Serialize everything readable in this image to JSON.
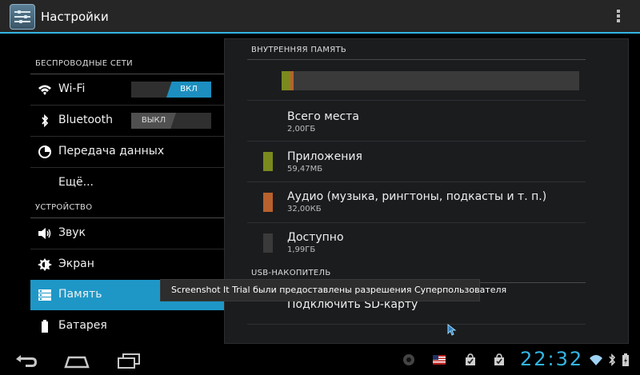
{
  "header": {
    "title": "Настройки",
    "app_icon": "settings-sliders-icon",
    "menu_icon": "overflow-menu-icon"
  },
  "sidebar": {
    "sections": [
      {
        "title": "БЕСПРОВОДНЫЕ СЕТИ",
        "items": [
          {
            "label": "Wi-Fi",
            "icon": "wifi-icon",
            "toggle": "ВКЛ",
            "toggle_state": "on"
          },
          {
            "label": "Bluetooth",
            "icon": "bluetooth-icon",
            "toggle": "ВЫКЛ",
            "toggle_state": "off"
          },
          {
            "label": "Передача данных",
            "icon": "data-usage-icon"
          },
          {
            "label": "Ещё...",
            "icon": ""
          }
        ]
      },
      {
        "title": "УСТРОЙСТВО",
        "items": [
          {
            "label": "Звук",
            "icon": "speaker-icon"
          },
          {
            "label": "Экран",
            "icon": "brightness-icon"
          },
          {
            "label": "Память",
            "icon": "storage-icon",
            "selected": true
          },
          {
            "label": "Батарея",
            "icon": "battery-icon"
          }
        ]
      }
    ]
  },
  "storage": {
    "internal_header": "ВНУТРЕННЯЯ ПАМЯТЬ",
    "usage": {
      "apps_fraction": 0.029,
      "audio_fraction": 0.012
    },
    "total": {
      "label": "Всего места",
      "value": "2,00ГБ"
    },
    "entries": [
      {
        "label": "Приложения",
        "value": "59,47МБ",
        "color": "#7a8a1e"
      },
      {
        "label": "Аудио (музыка, рингтоны, подкасты и т. п.)",
        "value": "32,00КБ",
        "color": "#b8612d"
      },
      {
        "label": "Доступно",
        "value": "1,99ГБ",
        "color": "#3a3a3a"
      }
    ],
    "usb_header": "USB-НАКОПИТЕЛЬ",
    "mount_label": "Подключить SD-карту"
  },
  "toast": "Screenshot It Trial были предоставлены разрешения Суперпользователя",
  "statusbar": {
    "time": "22:32",
    "nav_icons": [
      "back-icon",
      "home-icon",
      "recents-icon"
    ],
    "tray_icons": [
      "record-icon",
      "us-flag-icon",
      "bag-check-icon",
      "bag-check-icon",
      "wifi-signal-icon",
      "bluetooth-icon",
      "battery-icon"
    ]
  }
}
